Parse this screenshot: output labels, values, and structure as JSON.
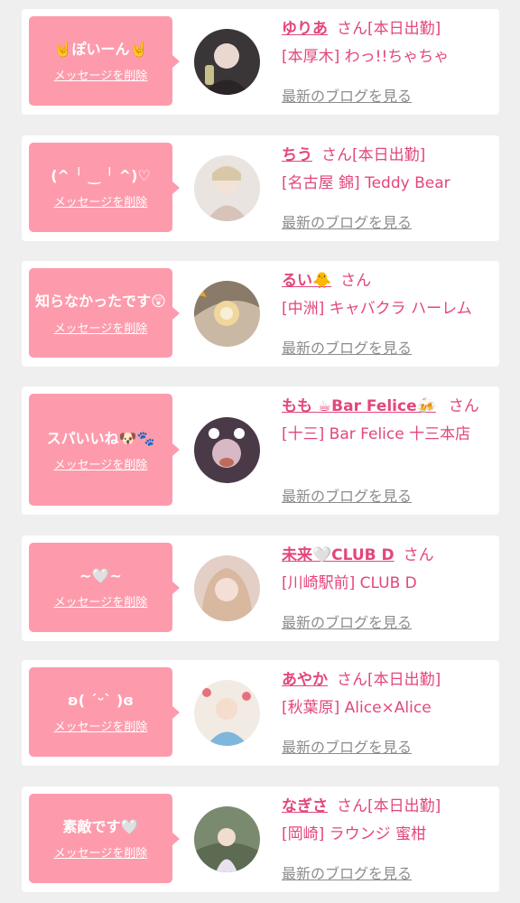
{
  "ui": {
    "delete_label": "メッセージを削除",
    "blog_label": "最新のブログを見る",
    "honorific": "さん"
  },
  "colors": {
    "bubble": "#fd9bac",
    "accent": "#e2477a",
    "link_gray": "#8c8c8c",
    "background": "#efefef"
  },
  "messages": [
    {
      "text": "🤘ぽいーん🤘",
      "name": "ゆりあ",
      "tag": "[本日出勤]",
      "shop": "[本厚木] わっ!!ちゃちゃ",
      "avatar": "#3a3536"
    },
    {
      "text": "(^ ╵ ‿ ╵ ^)♡",
      "name": "ちう",
      "tag": "[本日出勤]",
      "shop": "[名古屋 錦] Teddy Bear",
      "avatar": "#e9e4df"
    },
    {
      "text": "知らなかったです😲",
      "name": "るい🐥",
      "tag": "",
      "shop": "[中洲] キャバクラ ハーレム",
      "avatar": "#c9b9a4"
    },
    {
      "text": "スパいいね🐶🐾",
      "name": "もも ☕Bar Felice🍻",
      "tag": "",
      "shop": "[十三] Bar Felice 十三本店",
      "avatar": "#4a3a48"
    },
    {
      "text": "~🤍~",
      "name": "未来🤍CLUB D",
      "tag": "",
      "shop": "[川崎駅前] CLUB D",
      "avatar": "#e3cfc6"
    },
    {
      "text": "ʚ( ˊᵕˋ )ɞ",
      "name": "あやか",
      "tag": "[本日出勤]",
      "shop": "[秋葉原] Alice×Alice",
      "avatar": "#f2ebe4"
    },
    {
      "text": "素敵です🤍",
      "name": "なぎさ",
      "tag": "[本日出勤]",
      "shop": "[岡崎] ラウンジ 蜜柑",
      "avatar": "#7a8a6e"
    }
  ]
}
